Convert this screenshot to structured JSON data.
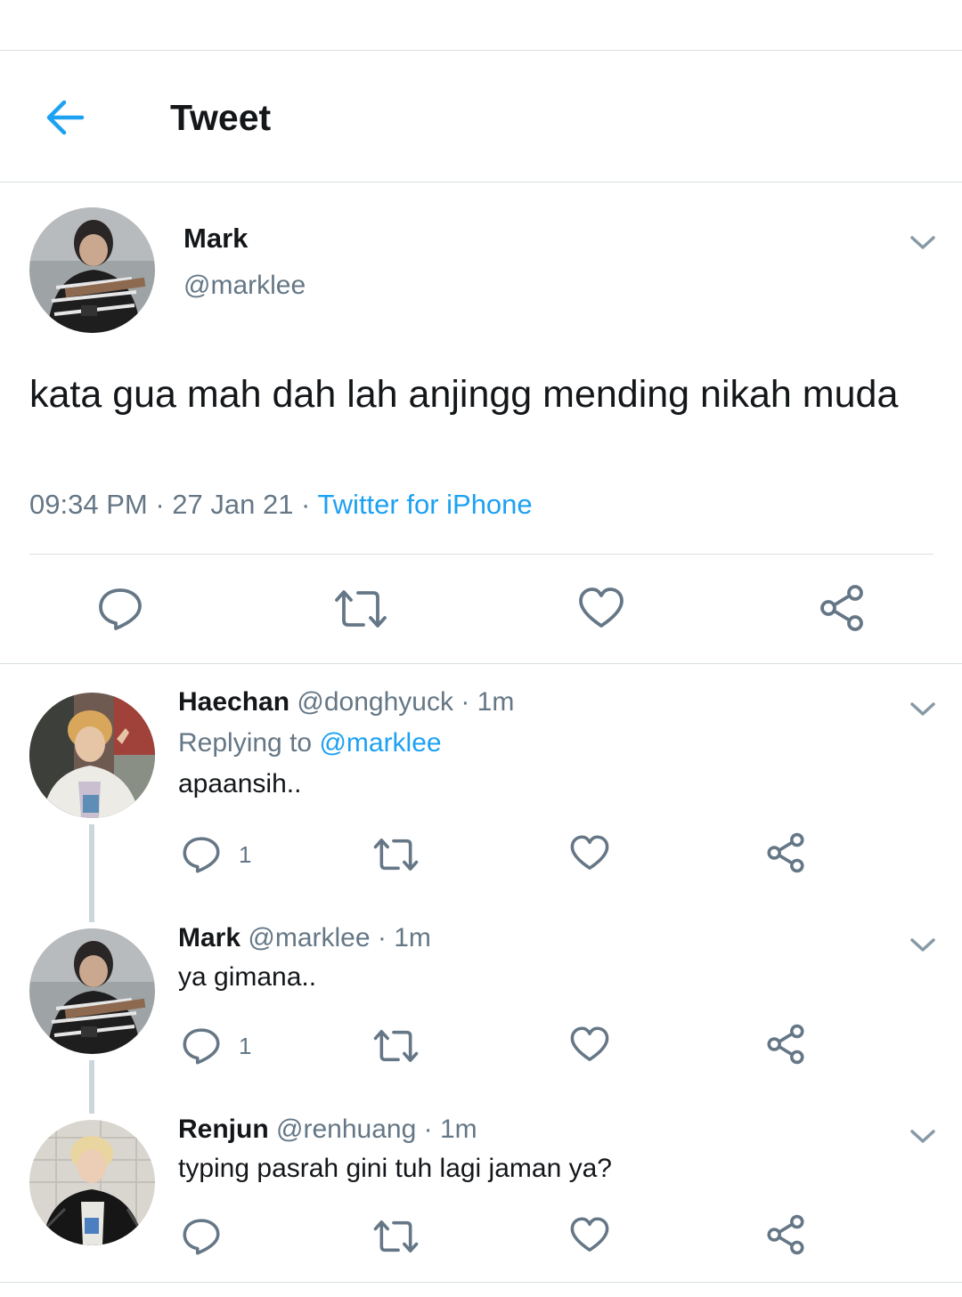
{
  "header": {
    "title": "Tweet",
    "back_icon": "arrow-left-icon",
    "accent": "#1da1f2"
  },
  "main_tweet": {
    "name": "Mark",
    "handle": "@marklee",
    "text": "kata gua mah dah lah anjingg mending nikah muda",
    "time": "09:34 PM",
    "separator": " · ",
    "date": "27 Jan 21",
    "source": "Twitter for iPhone"
  },
  "replies": [
    {
      "name": "Haechan",
      "handle": "@donghyuck",
      "time": "1m",
      "replying_label": "Replying to",
      "replying_to": "@marklee",
      "text": "apaansih..",
      "reply_count": "1"
    },
    {
      "name": "Mark",
      "handle": "@marklee",
      "time": "1m",
      "text": "ya gimana..",
      "reply_count": "1"
    },
    {
      "name": "Renjun",
      "handle": "@renhuang",
      "time": "1m",
      "text": "typing pasrah gini tuh lagi jaman ya?",
      "reply_count": ""
    }
  ],
  "icons": [
    "reply-icon",
    "retweet-icon",
    "like-icon",
    "share-icon",
    "chevron-down-icon"
  ]
}
